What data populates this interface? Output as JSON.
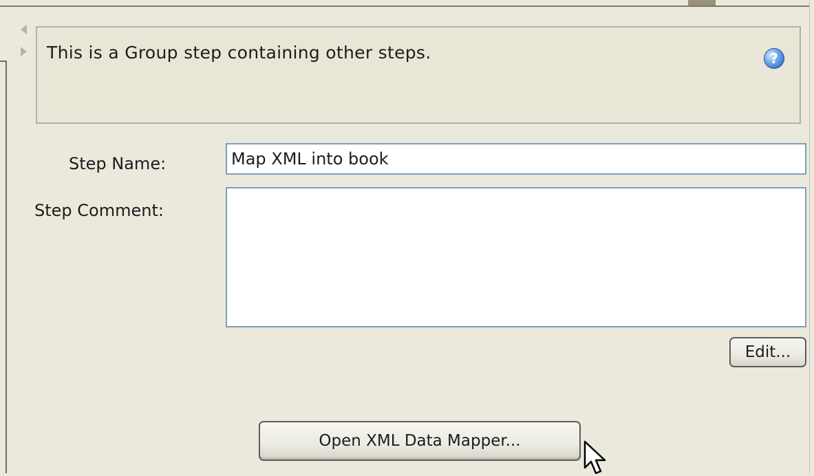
{
  "info": {
    "text": "This is a Group step containing other steps.",
    "help_icon": "question-circle"
  },
  "step_name": {
    "label": "Step Name:",
    "value": "Map XML into book"
  },
  "step_comment": {
    "label": "Step Comment:",
    "value": ""
  },
  "buttons": {
    "edit": "Edit...",
    "open_mapper": "Open XML Data Mapper..."
  },
  "colors": {
    "background": "#ebe8dc",
    "input_border": "#7f9db9",
    "help_icon": "#2c68b8"
  }
}
